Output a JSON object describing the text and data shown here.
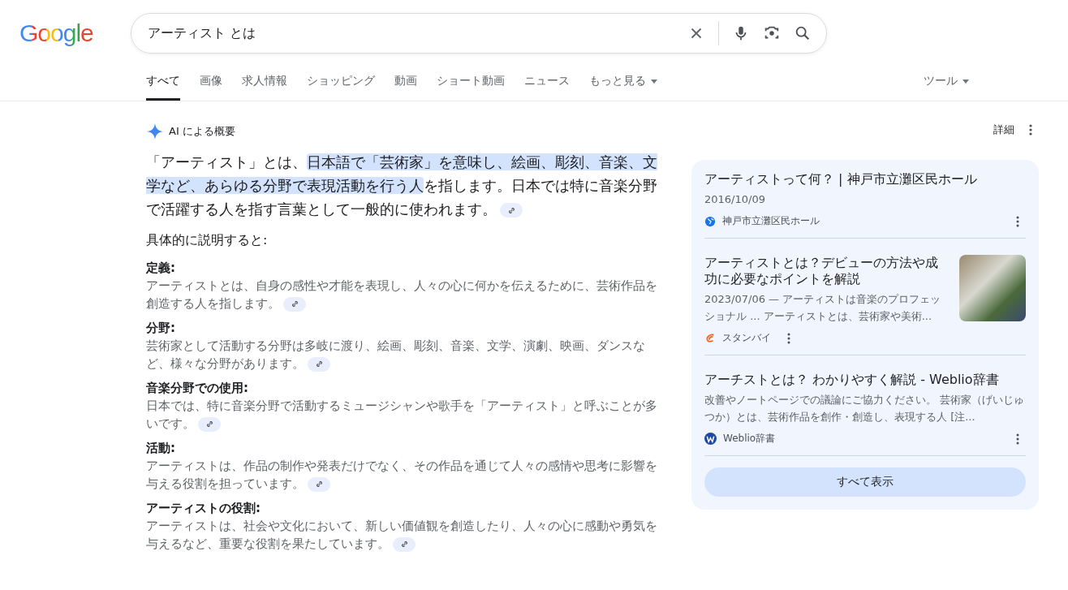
{
  "logo": "Google",
  "search": {
    "value": "アーティスト とは"
  },
  "tabs": [
    {
      "label": "すべて",
      "selected": true,
      "dropdown": false
    },
    {
      "label": "画像",
      "selected": false,
      "dropdown": false
    },
    {
      "label": "求人情報",
      "selected": false,
      "dropdown": false
    },
    {
      "label": "ショッピング",
      "selected": false,
      "dropdown": false
    },
    {
      "label": "動画",
      "selected": false,
      "dropdown": false
    },
    {
      "label": "ショート動画",
      "selected": false,
      "dropdown": false
    },
    {
      "label": "ニュース",
      "selected": false,
      "dropdown": false
    },
    {
      "label": "もっと見る",
      "selected": false,
      "dropdown": true
    }
  ],
  "tools": {
    "label": "ツール"
  },
  "overview": {
    "title": "AI による概要",
    "details": "詳細",
    "intro": [
      {
        "text": "「アーティスト」とは、",
        "highlighted": false
      },
      {
        "text": "日本語で「芸術家」を意味し、絵画、彫刻、音楽、文学など、あらゆる分野で表現活動を行う人",
        "highlighted": true
      },
      {
        "text": "を指します。日本では特に音楽分野で活躍する人を指す言葉として一般的に使われます。",
        "highlighted": false
      }
    ],
    "lead": "具体的に説明すると:",
    "sections": [
      {
        "heading": "定義:",
        "text": "アーティストとは、自身の感性や才能を表現し、人々の心に何かを伝えるために、芸術作品を創造する人を指します。"
      },
      {
        "heading": "分野:",
        "text": "芸術家として活動する分野は多岐に渡り、絵画、彫刻、音楽、文学、演劇、映画、ダンスなど、様々な分野があります。"
      },
      {
        "heading": "音楽分野での使用:",
        "text": "日本では、特に音楽分野で活動するミュージシャンや歌手を「アーティスト」と呼ぶことが多いです。"
      },
      {
        "heading": "活動:",
        "text": "アーティストは、作品の制作や発表だけでなく、その作品を通じて人々の感情や思考に影響を与える役割を担っています。"
      },
      {
        "heading": "アーティストの役割:",
        "text": "アーティストは、社会や文化において、新しい価値観を創造したり、人々の心に感動や勇気を与えるなど、重要な役割を果たしています。"
      }
    ]
  },
  "sources": [
    {
      "title": "アーティストって何？ | 神戸市立灘区民ホール",
      "snippet": "2016/10/09",
      "site": "神戸市立灘区民ホール",
      "kind": "globe",
      "thumbnail": false
    },
    {
      "title": "アーティストとは？デビューの方法や成功に必要なポイントを解説",
      "snippet": "2023/07/06 — アーティストは音楽のプロフェッショナル ... アーティストとは、芸術家や美術...",
      "site": "スタンバイ",
      "kind": "swirl",
      "thumbnail": true
    },
    {
      "title": "アーチストとは？ わかりやすく解説 - Weblio辞書",
      "snippet": "改善やノートページでの議論にご協力ください。 芸術家（げいじゅつか）とは、芸術作品を創作・創造し、表現する人 [注...",
      "site": "Weblio辞書",
      "kind": "letter",
      "thumbnail": false
    }
  ],
  "show_all": "すべて表示"
}
